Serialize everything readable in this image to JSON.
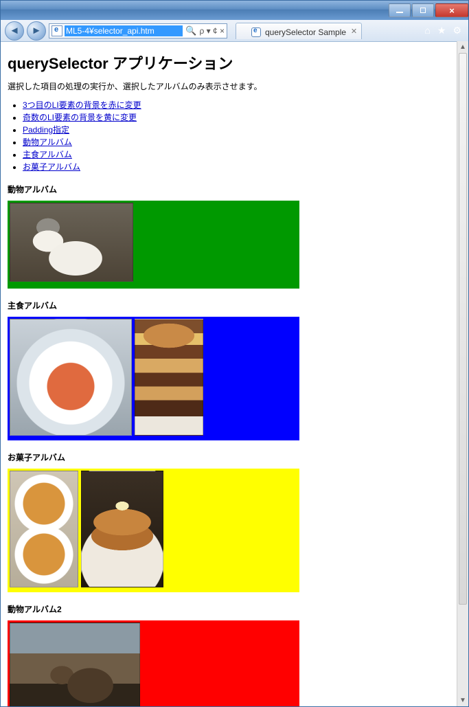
{
  "window": {
    "address_text": "ML5-4¥selector_api.htm",
    "address_suffix": "ρ ▾ ¢ ×",
    "tab_title": "querySelector Sample"
  },
  "page": {
    "h1": "querySelector アプリケーション",
    "note": "選択した項目の処理の実行か、選択したアルバムのみ表示させます。",
    "links": [
      "3つ目のLI要素の背景を赤に変更",
      "奇数のLI要素の背景を黄に変更",
      "Padding指定",
      "動物アルバム",
      "主食アルバム",
      "お菓子アルバム"
    ],
    "albums": [
      {
        "title": "動物アルバム",
        "color": "green",
        "thumbs": [
          "cat"
        ]
      },
      {
        "title": "主食アルバム",
        "color": "blue",
        "thumbs": [
          "bowl",
          "burger"
        ]
      },
      {
        "title": "お菓子アルバム",
        "color": "yellow",
        "thumbs": [
          "flan1",
          "pancake"
        ]
      },
      {
        "title": "動物アルバム2",
        "color": "red",
        "thumbs": [
          "boar"
        ]
      }
    ]
  }
}
